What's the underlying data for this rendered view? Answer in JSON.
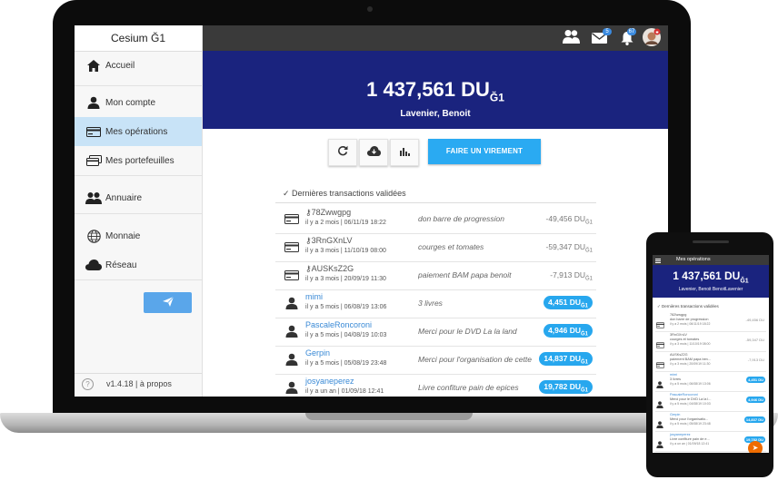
{
  "app": {
    "title": "Cesium Ğ1",
    "version": "v1.4.18 | à propos"
  },
  "sidebar": {
    "items": [
      {
        "label": "Accueil",
        "icon": "home-icon"
      },
      {
        "label": "Mon compte",
        "icon": "person-icon"
      },
      {
        "label": "Mes opérations",
        "icon": "card-icon"
      },
      {
        "label": "Mes portefeuilles",
        "icon": "wallets-icon"
      },
      {
        "label": "Annuaire",
        "icon": "people-icon"
      },
      {
        "label": "Monnaie",
        "icon": "globe-icon"
      },
      {
        "label": "Réseau",
        "icon": "cloud-icon"
      }
    ]
  },
  "topbar": {
    "mail_count": "5",
    "notif_count": "67"
  },
  "wallet": {
    "balance": "1 437,561 DU",
    "unit_sub": "Ğ1",
    "owner": "Lavenier, Benoit"
  },
  "actions": {
    "transfer_label": "FAIRE UN VIREMENT"
  },
  "transactions": {
    "title": "✓ Dernières transactions validées",
    "items": [
      {
        "kind": "card",
        "name": "78Zwwgpg",
        "date": "il y a 2 mois | 06/11/19 18:22",
        "comment": "don barre de progression",
        "amount": "-49,456 DU",
        "unit": "Ğ1",
        "incoming": false
      },
      {
        "kind": "card",
        "name": "3RnGXnLV",
        "date": "il y a 3 mois | 11/10/19 08:00",
        "comment": "courges et tomates",
        "amount": "-59,347 DU",
        "unit": "Ğ1",
        "incoming": false
      },
      {
        "kind": "card",
        "name": "AUSKsZ2G",
        "date": "il y a 3 mois | 20/09/19 11:30",
        "comment": "paiement BAM papa benoit",
        "amount": "-7,913 DU",
        "unit": "Ğ1",
        "incoming": false
      },
      {
        "kind": "person",
        "name": "mimi",
        "date": "il y a 5 mois | 06/08/19 13:06",
        "comment": "3 livres",
        "amount": "4,451 DU",
        "unit": "Ğ1",
        "incoming": true
      },
      {
        "kind": "person",
        "name": "PascaleRoncoroni",
        "date": "il y a 5 mois | 04/08/19 10:03",
        "comment": "Merci pour le DVD La la land",
        "amount": "4,946 DU",
        "unit": "Ğ1",
        "incoming": true
      },
      {
        "kind": "person",
        "name": "Gerpin",
        "date": "il y a 5 mois | 05/08/19 23:48",
        "comment": "Merci pour l'organisation de cette",
        "amount": "14,837 DU",
        "unit": "Ğ1",
        "incoming": true
      },
      {
        "kind": "person",
        "name": "josyaneperez",
        "date": "il y a un an | 01/09/18 12:41",
        "comment": "Livre confiture pain de epices",
        "amount": "19,782 DU",
        "unit": "Ğ1",
        "incoming": true
      }
    ]
  },
  "mobile": {
    "title": "Mes opérations",
    "balance": "1 437,561 DU",
    "unit_sub": "Ğ1",
    "owner": "Lavenier, Benoit BenoitLavenier",
    "tx_title": "✓ Dernières transactions validées",
    "items": [
      {
        "kind": "card",
        "name": "78Zwwgpg",
        "comment": "don barre de progression",
        "date": "il y a 2 mois | 06/11/19 18:22",
        "amount": "-49,456 DU",
        "incoming": false
      },
      {
        "kind": "card",
        "name": "3RnGXnLV",
        "comment": "courges et tomates",
        "date": "il y a 3 mois | 11/10/19 08:00",
        "amount": "-59,347 DU",
        "incoming": false
      },
      {
        "kind": "card",
        "name": "AUSKsZ2G",
        "comment": "paiement BAM papa ben...",
        "date": "il y a 3 mois | 20/09/19 11:30",
        "amount": "-7,913 DU",
        "incoming": false
      },
      {
        "kind": "person",
        "name": "mimi",
        "comment": "3 livres",
        "date": "il y a 5 mois | 06/08/19 13:06",
        "amount": "4,451 DU",
        "incoming": true
      },
      {
        "kind": "person",
        "name": "PascaleRoncoroni",
        "comment": "Merci pour le DVD La la l...",
        "date": "il y a 5 mois | 04/08/19 10:03",
        "amount": "4,946 DU",
        "incoming": true
      },
      {
        "kind": "person",
        "name": "Gerpin",
        "comment": "Merci pour l'organisatio...",
        "date": "il y a 5 mois | 05/08/19 23:48",
        "amount": "14,837 DU",
        "incoming": true
      },
      {
        "kind": "person",
        "name": "josyaneperez",
        "comment": "Livre confiture pain de e...",
        "date": "il y a un an | 01/09/18 12:41",
        "amount": "19,782 DU",
        "incoming": true
      }
    ]
  },
  "colors": {
    "banner": "#1a237e",
    "accent": "#2aaaf2",
    "topbar": "#3a3a3a",
    "active_nav": "#c8e3f7",
    "fab": "#ef6c00"
  }
}
